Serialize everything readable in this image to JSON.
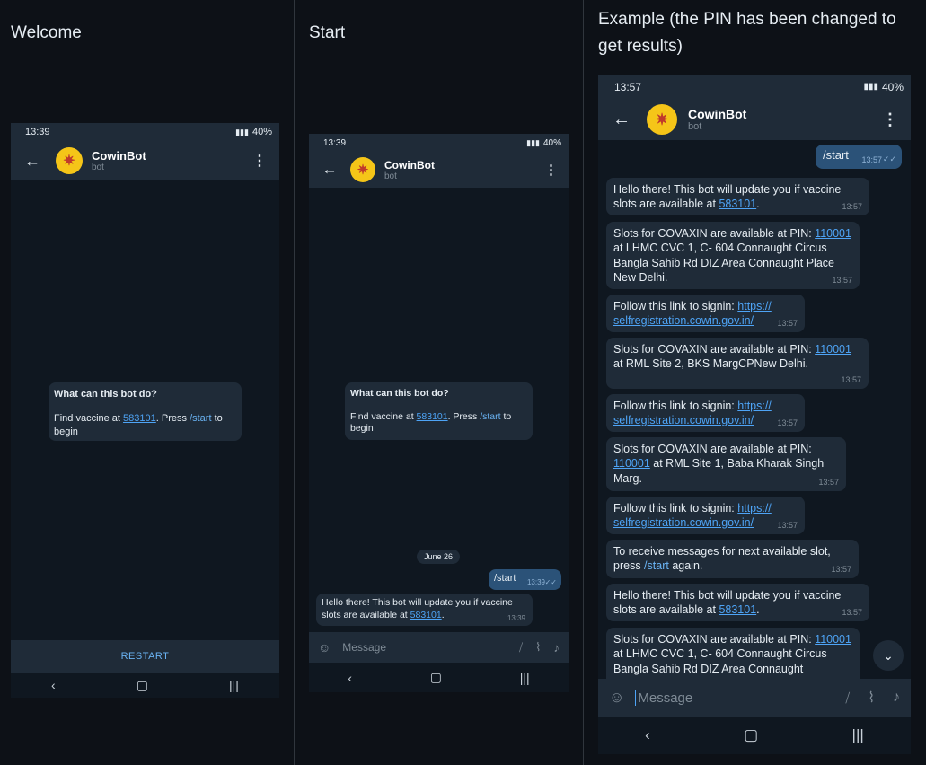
{
  "columns": {
    "welcome": "Welcome",
    "start": "Start",
    "example": "Example (the PIN has been changed to get results)"
  },
  "bot": {
    "name": "CowinBot",
    "sub": "bot",
    "avatar_icon": "virus-avatar-icon"
  },
  "welcome": {
    "status_time": "13:39",
    "status_right": "40%",
    "intro_title": "What can this bot do?",
    "intro_prefix": "Find vaccine at ",
    "intro_pin": "583101",
    "intro_mid": ". Press ",
    "intro_cmd": "/start",
    "intro_suffix": " to begin",
    "restart_label": "RESTART"
  },
  "start": {
    "status_time": "13:39",
    "status_right": "40%",
    "date_chip": "June 26",
    "out_text": "/start",
    "out_time": "13:39",
    "reply_prefix": "Hello there! This bot will update you if vaccine slots are available at ",
    "reply_pin": "583101",
    "reply_suffix": ".",
    "reply_time": "13:39",
    "input_placeholder": "Message"
  },
  "example": {
    "status_time": "13:57",
    "status_right": "40%",
    "out_text": "/start",
    "out_time": "13:57",
    "msg1_prefix": "Hello there! This bot will update you if vaccine slots are available at ",
    "msg1_pin": "583101",
    "msg1_time": "13:57",
    "msg2_prefix": "Slots for COVAXIN are available at PIN: ",
    "msg2_pin": "110001",
    "msg2_suffix": " at LHMC CVC 1, C- 604 Connaught Circus Bangla Sahib Rd DIZ Area Connaught Place New Delhi.",
    "msg2_time": "13:57",
    "link_prefix": "Follow this link to signin: ",
    "link_url": "https:// selfregistration.cowin.gov.in/",
    "msg3_time": "13:57",
    "msg4_suffix": " at RML Site 2, BKS MargCPNew Delhi.",
    "msg4_time": "13:57",
    "link2_prefix": "Follow this link to signin: ",
    "msg5_time": "13:57",
    "msg6_suffix": " at RML Site 1, Baba Kharak Singh Marg.",
    "msg6_time": "13:57",
    "msg7_time": "13:57",
    "msg8_prefix": "To receive messages for next available slot, press ",
    "msg8_cmd": "/start",
    "msg8_suffix": " again.",
    "msg8_time": "13:57",
    "msg9_time": "13:57",
    "msg10_suffix": " at LHMC CVC 1, C- 604 Connaught Circus Bangla Sahib Rd DIZ Area Connaught",
    "input_placeholder": "Message"
  }
}
